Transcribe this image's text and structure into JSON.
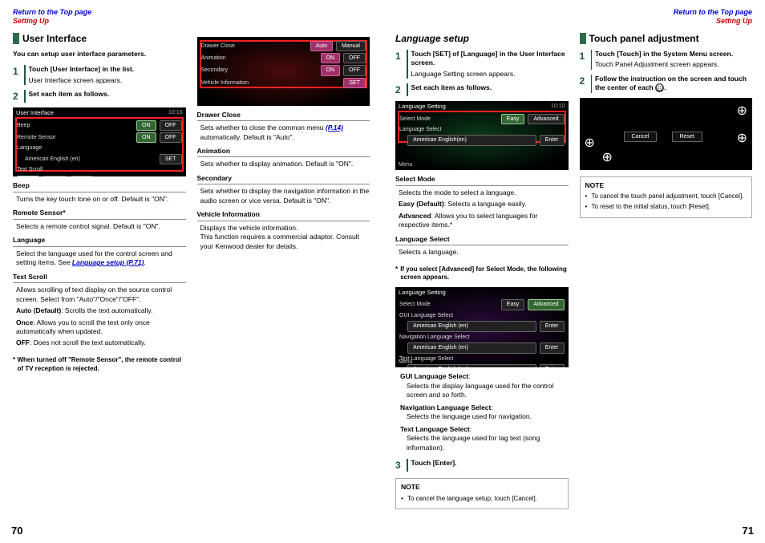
{
  "nav": {
    "top": "Return to the Top page",
    "setting": "Setting Up"
  },
  "left": {
    "title": "User Interface",
    "intro": "You can setup user interface parameters.",
    "step1": "Touch [User Interface] in the list.",
    "step1desc": "User Interface screen appears.",
    "step2": "Set each item as follows.",
    "ss1": {
      "title": "User Interface",
      "time": "10:10",
      "rows": {
        "beep": "Beep",
        "remote": "Remote Sensor",
        "lang": "Language",
        "lang_val": "American English (en)",
        "text": "Text Scroll"
      },
      "btn": {
        "on": "ON",
        "off": "OFF",
        "set": "SET",
        "auto": "Auto",
        "once": "Once"
      }
    },
    "params": {
      "beep": {
        "name": "Beep",
        "desc": "Turns the key touch tone on or off. Default is \"ON\"."
      },
      "remote": {
        "name": "Remote Sensor*",
        "desc": "Selects a remote control signal. Default is \"ON\"."
      },
      "lang": {
        "name": "Language",
        "desc1": "Select the language used for the control screen and setting items. See ",
        "link": "Language setup (P.71)",
        "desc2": "."
      },
      "text": {
        "name": "Text Scroll",
        "desc": "Allows scrolling of text display on the source control screen. Select from \"Auto\"/\"Once\"/\"OFF\".",
        "auto": "Auto (Default)",
        "auto_d": ": Scrolls the text automatically.",
        "once": "Once",
        "once_d": ": Allows you to scroll the text only once automatically when updated.",
        "off": "OFF",
        "off_d": ": Does not scroll the text automatically."
      }
    },
    "note_remote": "When turned off \"Remote Sensor\", the remote control of TV reception is rejected."
  },
  "left2": {
    "ss2": {
      "rows": {
        "drawer": "Drawer Close",
        "anim": "Animation",
        "second": "Secondary",
        "vinfo": "Vehicle Information"
      },
      "btn": {
        "auto": "Auto",
        "manual": "Manual",
        "on": "ON",
        "off": "OFF",
        "set": "SET"
      }
    },
    "params": {
      "drawer": {
        "name": "Drawer Close",
        "desc1": "Sets whether to close the common menu ",
        "link": "(P.14)",
        "desc2": " automatically. Default is \"Auto\"."
      },
      "anim": {
        "name": "Animation",
        "desc": "Sets whether to display animation. Default is \"ON\"."
      },
      "second": {
        "name": "Secondary",
        "desc": "Sets whether to display the navigation information in the audio screen or vice versa. Default is \"ON\"."
      },
      "vinfo": {
        "name": "Vehicle Information",
        "desc": "Displays the vehicle information.\nThis function requires a commercial adaptor. Consult your Kenwood dealer for details."
      }
    }
  },
  "right": {
    "lang_title": "Language setup",
    "step1": "Touch [SET] of [Language] in the User Interface screen.",
    "step1desc": "Language Setting screen appears.",
    "step2": "Set each item as follows.",
    "ss_lang": {
      "title": "Language Setting",
      "time": "10:10",
      "rows": {
        "mode": "Select Mode",
        "sel": "Language Select",
        "val": "American English(en)"
      },
      "btn": {
        "easy": "Easy",
        "adv": "Advanced",
        "enter": "Enter"
      },
      "menu": "Menu"
    },
    "params": {
      "mode": {
        "name": "Select Mode",
        "desc": "Selects the mode to select a language.",
        "easy": "Easy (Default)",
        "easy_d": ": Selects a language easily.",
        "adv": "Advanced",
        "adv_d": ": Allows you to select languages for respective items.*"
      },
      "sel": {
        "name": "Language Select",
        "desc": "Selects a language."
      }
    },
    "adv_note": "If you select [Advanced] for Select Mode, the following screen appears.",
    "ss_adv": {
      "title": "Language Setting",
      "rows": {
        "mode": "Select Mode",
        "gui": "GUI Language Select",
        "nav": "Navigation Language Select",
        "text": "Text Language Select",
        "val": "American English (en)"
      },
      "btn": {
        "easy": "Easy",
        "adv": "Advanced",
        "enter": "Enter"
      },
      "menu": "Menu"
    },
    "sub": {
      "gui": {
        "n": "GUI Language Select",
        "d": "Selects the display language used for the control screen and so forth."
      },
      "nav": {
        "n": "Navigation Language Select",
        "d": "Selects the language used for navigation."
      },
      "text": {
        "n": "Text Language Select",
        "d": "Selects the language used for tag text (song information)."
      }
    },
    "step3": "Touch [Enter].",
    "note_cancel": "To cancel the language setup, touch [Cancel]."
  },
  "right2": {
    "title": "Touch panel adjustment",
    "step1": "Touch [Touch] in the System Menu screen.",
    "step1desc": "Touch Panel Adjustment screen appears.",
    "step2a": "Follow the instruction on the screen and touch the center of each ",
    "step2b": ".",
    "touch_ss": {
      "cancel": "Cancel",
      "reset": "Reset"
    },
    "note1": "To cancel the touch panel adjustment, touch [Cancel].",
    "note2": "To reset to the initial status, touch [Reset]."
  },
  "pages": {
    "l": "70",
    "r": "71"
  },
  "note_label": "NOTE"
}
